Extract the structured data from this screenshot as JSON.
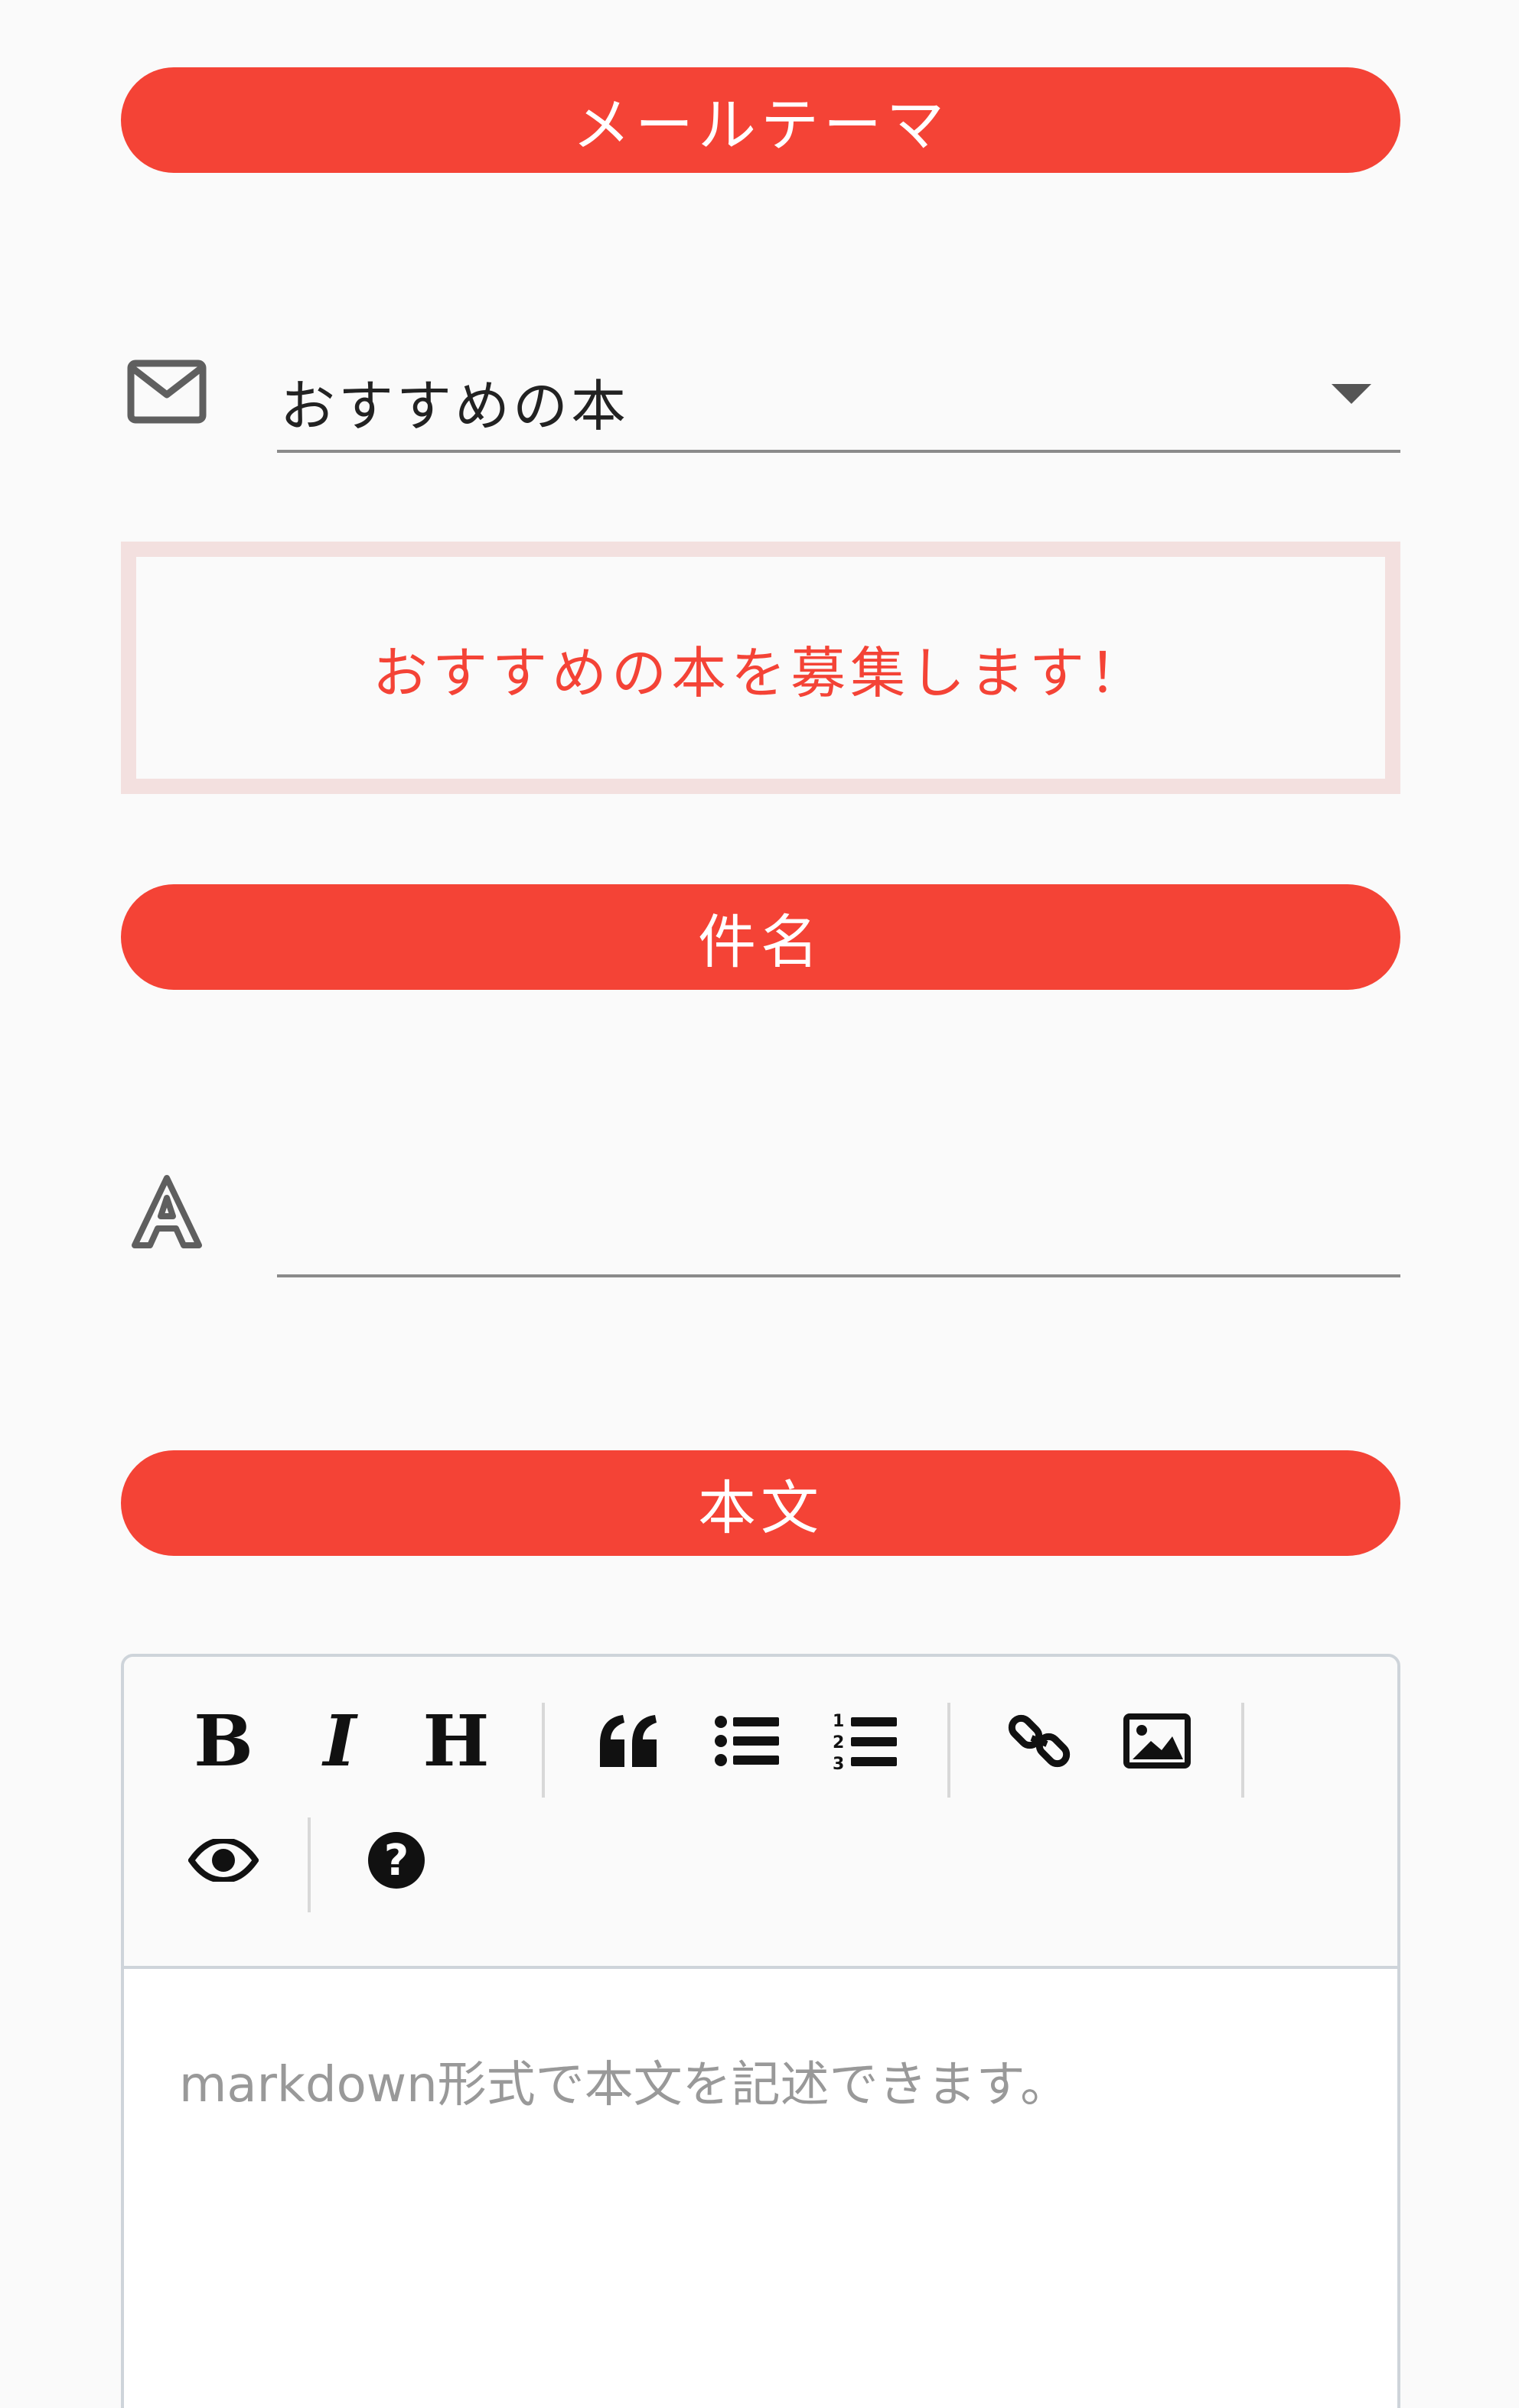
{
  "sections": {
    "mail_theme": "メールテーマ",
    "subject": "件名",
    "body": "本文"
  },
  "theme_select": {
    "selected": "おすすめの本",
    "icon": "mail-icon"
  },
  "notice": {
    "text": "おすすめの本を募集します！"
  },
  "subject_field": {
    "value": "",
    "placeholder": "",
    "icon": "font-a-icon"
  },
  "editor": {
    "toolbar": [
      "bold",
      "italic",
      "heading",
      "quote",
      "unordered-list",
      "ordered-list",
      "link",
      "image",
      "preview",
      "guide"
    ],
    "toolbar_glyphs": {
      "bold": "B",
      "italic": "I",
      "heading": "H",
      "quote": "❝",
      "guide": "?"
    },
    "placeholder": "markdown形式で本文を記述できます。",
    "value": ""
  },
  "colors": {
    "accent": "#f44336",
    "notice_border": "#f3e0df",
    "underline": "#8a8a8a",
    "background": "#fafafa"
  }
}
